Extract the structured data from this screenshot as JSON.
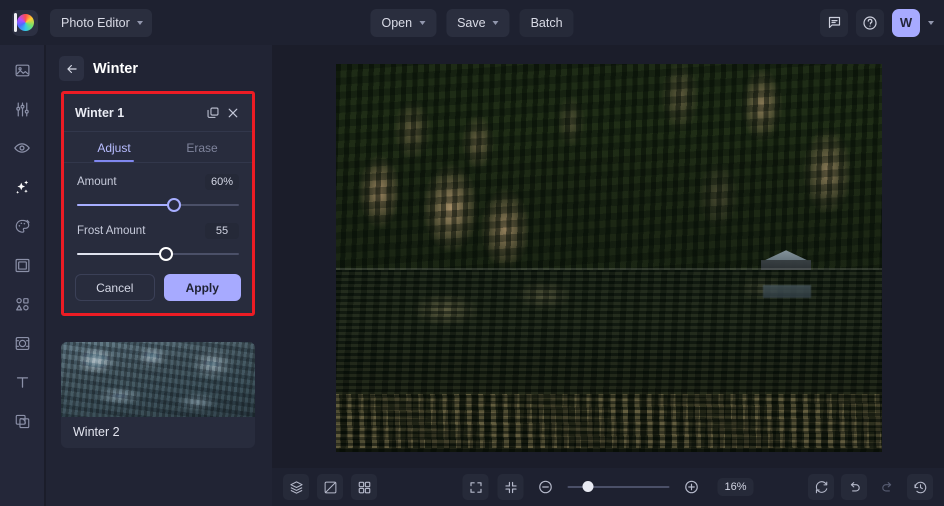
{
  "topbar": {
    "logo_icon": "color-wheel-logo-icon",
    "app_menu": {
      "label": "Photo Editor",
      "icon": "chevron-down-icon"
    },
    "buttons": [
      {
        "label": "Open",
        "icon": "chevron-down-icon",
        "has_chevron": true
      },
      {
        "label": "Save",
        "icon": "chevron-down-icon",
        "has_chevron": true
      },
      {
        "label": "Batch",
        "has_chevron": false
      }
    ],
    "right": {
      "feedback_icon": "chat-bubble-icon",
      "help_icon": "question-circle-icon",
      "avatar_initial": "W",
      "account_chevron_icon": "chevron-down-icon"
    }
  },
  "rail": {
    "items": [
      {
        "name": "image-icon",
        "label": "Image",
        "active": false
      },
      {
        "name": "adjust-sliders-icon",
        "label": "Adjust",
        "active": false
      },
      {
        "name": "eye-icon",
        "label": "Retouch",
        "active": false
      },
      {
        "name": "sparkles-icon",
        "label": "Effects",
        "active": true
      },
      {
        "name": "palette-icon",
        "label": "Color",
        "active": false
      },
      {
        "name": "frame-icon",
        "label": "Frames",
        "active": false
      },
      {
        "name": "shapes-icon",
        "label": "Elements",
        "active": false
      },
      {
        "name": "focus-crop-icon",
        "label": "Focus",
        "active": false
      },
      {
        "name": "text-icon",
        "label": "Text",
        "active": false
      },
      {
        "name": "layers-overlay-icon",
        "label": "Overlays",
        "active": false
      }
    ]
  },
  "panel": {
    "back_icon": "arrow-left-icon",
    "title": "Winter",
    "dialog": {
      "title": "Winter 1",
      "duplicate_icon": "duplicate-icon",
      "close_icon": "close-icon",
      "tabs": [
        {
          "label": "Adjust",
          "active": true
        },
        {
          "label": "Erase",
          "active": false
        }
      ],
      "sliders": [
        {
          "label": "Amount",
          "value": "60%",
          "percent": 60,
          "style": "accent"
        },
        {
          "label": "Frost Amount",
          "value": "55",
          "percent": 55,
          "style": "white"
        }
      ],
      "cancel_label": "Cancel",
      "apply_label": "Apply",
      "highlight_color": "#ec1c24"
    },
    "preset": {
      "name": "Winter 2",
      "thumb_alt": "frosted-forest-lake-thumbnail"
    }
  },
  "canvas": {
    "image_alt": "dark-forest-lake-with-cabin-photo"
  },
  "bottombar": {
    "left_tools": [
      {
        "name": "layers-icon",
        "label": "Layers",
        "dim": false
      },
      {
        "name": "compare-split-icon",
        "label": "Compare",
        "dim": false
      },
      {
        "name": "grid-icon",
        "label": "Grid",
        "dim": false
      }
    ],
    "view_tools": [
      {
        "name": "fullscreen-icon",
        "label": "Fullscreen"
      },
      {
        "name": "fit-to-screen-icon",
        "label": "Fit to screen"
      }
    ],
    "zoom_out_icon": "zoom-out-icon",
    "zoom_in_icon": "zoom-in-icon",
    "zoom_value": "16%",
    "zoom_percent": 16,
    "right_tools": [
      {
        "name": "reset-icon",
        "label": "Reset",
        "dim": false
      },
      {
        "name": "undo-icon",
        "label": "Undo",
        "dim": false
      },
      {
        "name": "redo-icon",
        "label": "Redo",
        "dim": true
      },
      {
        "name": "history-icon",
        "label": "History",
        "dim": false
      }
    ]
  },
  "colors": {
    "app_bg": "#1b1d2a",
    "panel_bg": "#212434",
    "rail_bg": "#242739",
    "accent": "#a7aaff",
    "highlight": "#ec1c24"
  }
}
